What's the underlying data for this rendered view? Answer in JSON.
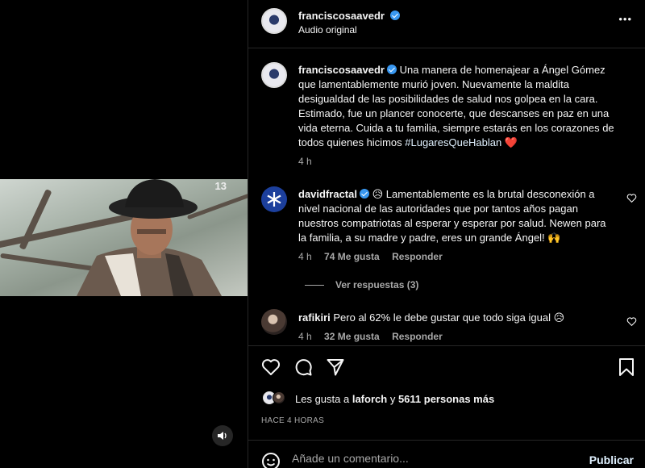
{
  "post": {
    "username": "franciscosaavedr",
    "audio": "Audio original",
    "more": "•••",
    "age_rating": "13"
  },
  "caption": {
    "username": "franciscosaavedr",
    "text": "Una manera de homenajear a Ángel Gómez que lamentablemente murió joven. Nuevamente la maldita desigualdad de las posibilidades de salud nos golpea en la cara. Estimado, fue un plancer conocerte, que descanses en paz en una vida eterna. Cuida a tu familia, siempre estarás en los corazones de todos quienes hicimos",
    "hashtag": "#LugaresQueHablan",
    "emoji": "❤️",
    "time": "4 h"
  },
  "comments": [
    {
      "username": "davidfractal",
      "emoji_lead": "😥",
      "text": "Lamentablemente es la brutal desconexión a nivel nacional de las autoridades que por tantos años pagan nuestros compatriotas al esperar y esperar por salud. Newen para la familia, a su madre y padre, eres un grande Ángel! 🙌",
      "time": "4 h",
      "likes": "74 Me gusta",
      "reply": "Responder",
      "view_replies": "Ver respuestas (3)"
    },
    {
      "username": "rafikiri",
      "text": "Pero al 62% le debe gustar que todo siga igual 😥",
      "time": "4 h",
      "likes": "32 Me gusta",
      "reply": "Responder"
    }
  ],
  "likes": {
    "prefix": "Les gusta a",
    "user": "laforch",
    "connector": "y",
    "count": "5611 personas más"
  },
  "timestamp": "HACE 4 HORAS",
  "add_comment": {
    "placeholder": "Añade un comentario...",
    "publish": "Publicar"
  },
  "colors": {
    "background": "#000000",
    "verified": "#3897f0",
    "publish": "#e0f1ff",
    "heart": "#e0245e"
  }
}
